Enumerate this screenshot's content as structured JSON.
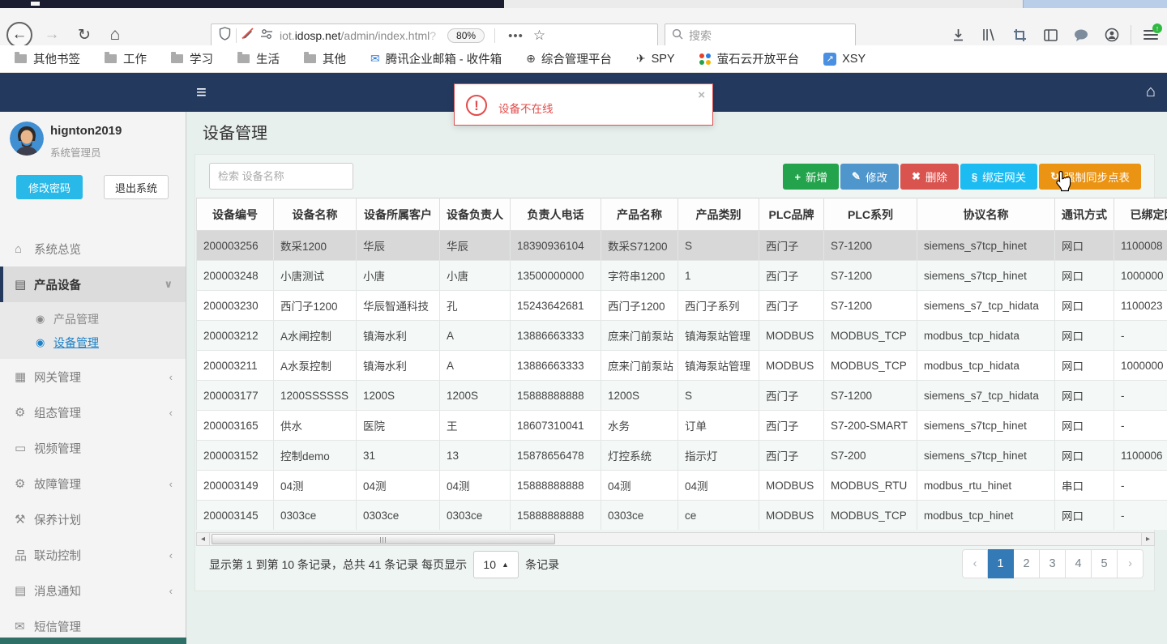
{
  "browser": {
    "url": {
      "prefix": "iot.",
      "domain": "idosp.net",
      "path": "/admin/index.html",
      "query": "?"
    },
    "zoom_badge": "80%",
    "search_placeholder": "搜索",
    "bookmarks": [
      {
        "name": "other-bookmarks",
        "label": "其他书签",
        "icon": "folder"
      },
      {
        "name": "work",
        "label": "工作",
        "icon": "folder"
      },
      {
        "name": "study",
        "label": "学习",
        "icon": "folder"
      },
      {
        "name": "life",
        "label": "生活",
        "icon": "folder"
      },
      {
        "name": "misc",
        "label": "其他",
        "icon": "folder"
      },
      {
        "name": "tencent-mail",
        "label": "腾讯企业邮箱 - 收件箱",
        "icon": "glyph",
        "glyph": "✉",
        "color": "#2f7bdc"
      },
      {
        "name": "admin-platform",
        "label": "综合管理平台",
        "icon": "glyph",
        "glyph": "⊕",
        "color": "#3b3b3b"
      },
      {
        "name": "spy",
        "label": "SPY",
        "icon": "glyph",
        "glyph": "✈",
        "color": "#333333"
      },
      {
        "name": "ys-cloud",
        "label": "萤石云开放平台",
        "icon": "dots"
      },
      {
        "name": "xsy",
        "label": "XSY",
        "icon": "badge",
        "glyph": "↗",
        "color": "#4a90e2"
      }
    ]
  },
  "app": {
    "alert": {
      "text": "设备不在线",
      "close": "×"
    },
    "user": {
      "name": "hignton2019",
      "role": "系统管理员",
      "change_pw": "修改密码",
      "logout": "退出系统"
    },
    "menu": [
      {
        "name": "system-overview",
        "icon": "home-icon",
        "glyph": "⌂",
        "label": "系统总览"
      },
      {
        "name": "product-device",
        "icon": "book-icon",
        "glyph": "▤",
        "label": "产品设备",
        "chevron": "∨",
        "active": true,
        "children": [
          {
            "name": "product-management",
            "icon": "circle-dot-icon",
            "glyph": "◉",
            "label": "产品管理"
          },
          {
            "name": "device-management",
            "icon": "circle-dot-icon",
            "glyph": "◉",
            "label": "设备管理",
            "active": true
          }
        ]
      },
      {
        "name": "gateway-management",
        "icon": "film-icon",
        "glyph": "▦",
        "label": "网关管理",
        "chevron": "‹"
      },
      {
        "name": "scada-management",
        "icon": "gears-icon",
        "glyph": "⚙",
        "label": "组态管理",
        "chevron": "‹"
      },
      {
        "name": "video-management",
        "icon": "monitor-icon",
        "glyph": "▭",
        "label": "视频管理"
      },
      {
        "name": "fault-management",
        "icon": "gears-icon",
        "glyph": "⚙",
        "label": "故障管理",
        "chevron": "‹"
      },
      {
        "name": "maintenance-plan",
        "icon": "wrench-icon",
        "glyph": "⚒",
        "label": "保养计划"
      },
      {
        "name": "linkage-control",
        "icon": "sitemap-icon",
        "glyph": "品",
        "label": "联动控制",
        "chevron": "‹"
      },
      {
        "name": "message-notify",
        "icon": "book-icon",
        "glyph": "▤",
        "label": "消息通知",
        "chevron": "‹"
      },
      {
        "name": "sms-management",
        "icon": "envelope-icon",
        "glyph": "✉",
        "label": "短信管理"
      }
    ],
    "page_title": "设备管理",
    "toolbar": {
      "search_placeholder": "检索 设备名称",
      "buttons": [
        {
          "name": "add",
          "label": "新增",
          "icon": "plus-icon",
          "glyph": "+",
          "color": "#23a34b"
        },
        {
          "name": "edit",
          "label": "修改",
          "icon": "pencil-icon",
          "glyph": "✎",
          "color": "#4e96cc"
        },
        {
          "name": "delete",
          "label": "删除",
          "icon": "cross-icon",
          "glyph": "✖",
          "color": "#d9534f"
        },
        {
          "name": "bind-gateway",
          "label": "绑定网关",
          "icon": "link-icon",
          "glyph": "§",
          "color": "#1cbcf2"
        },
        {
          "name": "force-sync",
          "label": "强制同步点表",
          "icon": "refresh-icon",
          "glyph": "↻",
          "color": "#eb9312"
        }
      ]
    },
    "table": {
      "columns": [
        "设备编号",
        "设备名称",
        "设备所属客户",
        "设备负责人",
        "负责人电话",
        "产品名称",
        "产品类别",
        "PLC品牌",
        "PLC系列",
        "协议名称",
        "通讯方式",
        "已绑定网关"
      ],
      "selected_row": 0,
      "rows": [
        [
          "200003256",
          "数采1200",
          "华辰",
          "华辰",
          "18390936104",
          "数采S71200",
          "S",
          "西门子",
          "S7-1200",
          "siemens_s7tcp_hinet",
          "网口",
          "1100008"
        ],
        [
          "200003248",
          "小唐测试",
          "小唐",
          "小唐",
          "13500000000",
          "字符串1200",
          "1",
          "西门子",
          "S7-1200",
          "siemens_s7tcp_hinet",
          "网口",
          "1000000"
        ],
        [
          "200003230",
          "西门子1200",
          "华辰智通科技",
          "孔",
          "15243642681",
          "西门子1200",
          "西门子系列",
          "西门子",
          "S7-1200",
          "siemens_s7_tcp_hidata",
          "网口",
          "1100023"
        ],
        [
          "200003212",
          "A水闸控制",
          "镇海水利",
          "A",
          "13886663333",
          "庶来门前泵站",
          "镇海泵站管理",
          "MODBUS",
          "MODBUS_TCP",
          "modbus_tcp_hidata",
          "网口",
          "-"
        ],
        [
          "200003211",
          "A水泵控制",
          "镇海水利",
          "A",
          "13886663333",
          "庶来门前泵站",
          "镇海泵站管理",
          "MODBUS",
          "MODBUS_TCP",
          "modbus_tcp_hidata",
          "网口",
          "1000000"
        ],
        [
          "200003177",
          "1200SSSSSS",
          "1200S",
          "1200S",
          "15888888888",
          "1200S",
          "S",
          "西门子",
          "S7-1200",
          "siemens_s7_tcp_hidata",
          "网口",
          "-"
        ],
        [
          "200003165",
          "供水",
          "医院",
          "王",
          "18607310041",
          "水务",
          "订单",
          "西门子",
          "S7-200-SMART",
          "siemens_s7tcp_hinet",
          "网口",
          "-"
        ],
        [
          "200003152",
          "控制demo",
          "31",
          "13",
          "15878656478",
          "灯控系统",
          "指示灯",
          "西门子",
          "S7-200",
          "siemens_s7tcp_hinet",
          "网口",
          "1100006"
        ],
        [
          "200003149",
          "04测",
          "04测",
          "04测",
          "15888888888",
          "04测",
          "04测",
          "MODBUS",
          "MODBUS_RTU",
          "modbus_rtu_hinet",
          "串口",
          "-"
        ],
        [
          "200003145",
          "0303ce",
          "0303ce",
          "0303ce",
          "15888888888",
          "0303ce",
          "ce",
          "MODBUS",
          "MODBUS_TCP",
          "modbus_tcp_hinet",
          "网口",
          "-"
        ]
      ]
    },
    "footer": {
      "info_prefix": "显示第 1 到第 10 条记录，总共 41 条记录 每页显示",
      "page_size": "10",
      "info_suffix": "条记录",
      "pages": [
        "1",
        "2",
        "3",
        "4",
        "5"
      ],
      "active_page": "1",
      "prev": "‹",
      "next": "›"
    },
    "colors": {
      "navbar": "#24395e",
      "accent_link": "#1d82c8",
      "pagination_active": "#337ab7",
      "alert": "#d9534f"
    }
  }
}
